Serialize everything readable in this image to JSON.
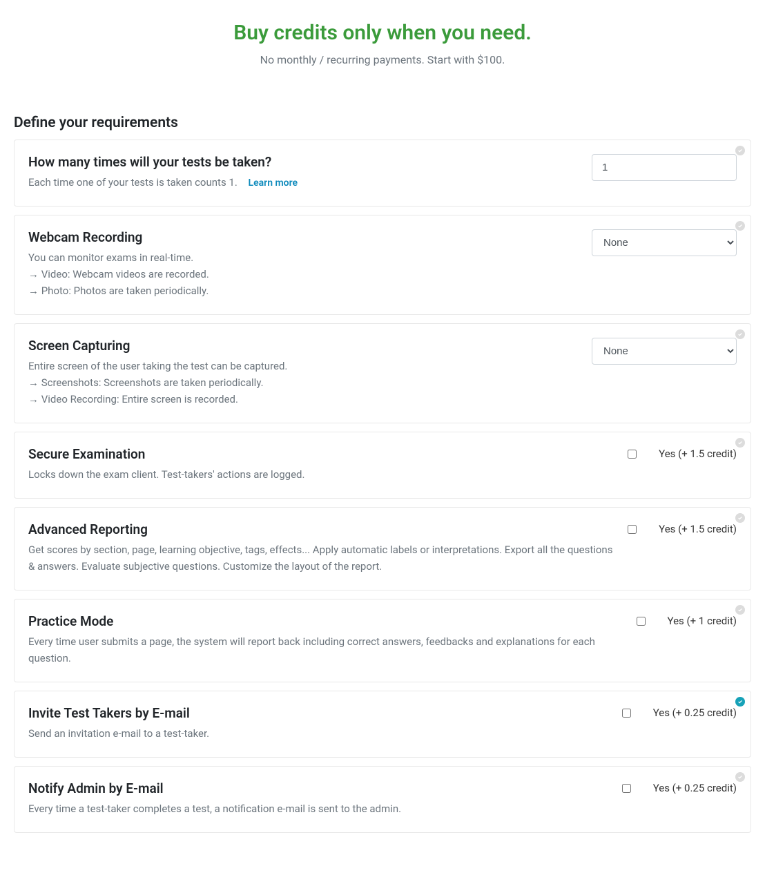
{
  "header": {
    "title": "Buy credits only when you need.",
    "subtitle": "No monthly / recurring payments. Start with $100."
  },
  "section_title": "Define your requirements",
  "items": {
    "times": {
      "title": "How many times will your tests be taken?",
      "desc": "Each time one of your tests is taken counts 1.",
      "learn_more": "Learn more",
      "value": "1"
    },
    "webcam": {
      "title": "Webcam Recording",
      "desc1": "You can monitor exams in real-time.",
      "desc2": "→ Video: Webcam videos are recorded.",
      "desc3": "→ Photo: Photos are taken periodically.",
      "selected": "None"
    },
    "screen": {
      "title": "Screen Capturing",
      "desc1": "Entire screen of the user taking the test can be captured.",
      "desc2": "→ Screenshots: Screenshots are taken periodically.",
      "desc3": "→ Video Recording: Entire screen is recorded.",
      "selected": "None"
    },
    "secure": {
      "title": "Secure Examination",
      "desc": "Locks down the exam client. Test-takers' actions are logged.",
      "label": "Yes (+ 1.5 credit)"
    },
    "reporting": {
      "title": "Advanced Reporting",
      "desc": "Get scores by section, page, learning objective, tags, effects... Apply automatic labels or interpretations. Export all the questions & answers. Evaluate subjective questions. Customize the layout of the report.",
      "label": "Yes (+ 1.5 credit)"
    },
    "practice": {
      "title": "Practice Mode",
      "desc": "Every time user submits a page, the system will report back including correct answers, feedbacks and explanations for each question.",
      "label": "Yes (+ 1 credit)"
    },
    "invite": {
      "title": "Invite Test Takers by E-mail",
      "desc": "Send an invitation e-mail to a test-taker.",
      "label": "Yes (+ 0.25 credit)"
    },
    "notify": {
      "title": "Notify Admin by E-mail",
      "desc": "Every time a test-taker completes a test, a notification e-mail is sent to the admin.",
      "label": "Yes (+ 0.25 credit)"
    }
  }
}
